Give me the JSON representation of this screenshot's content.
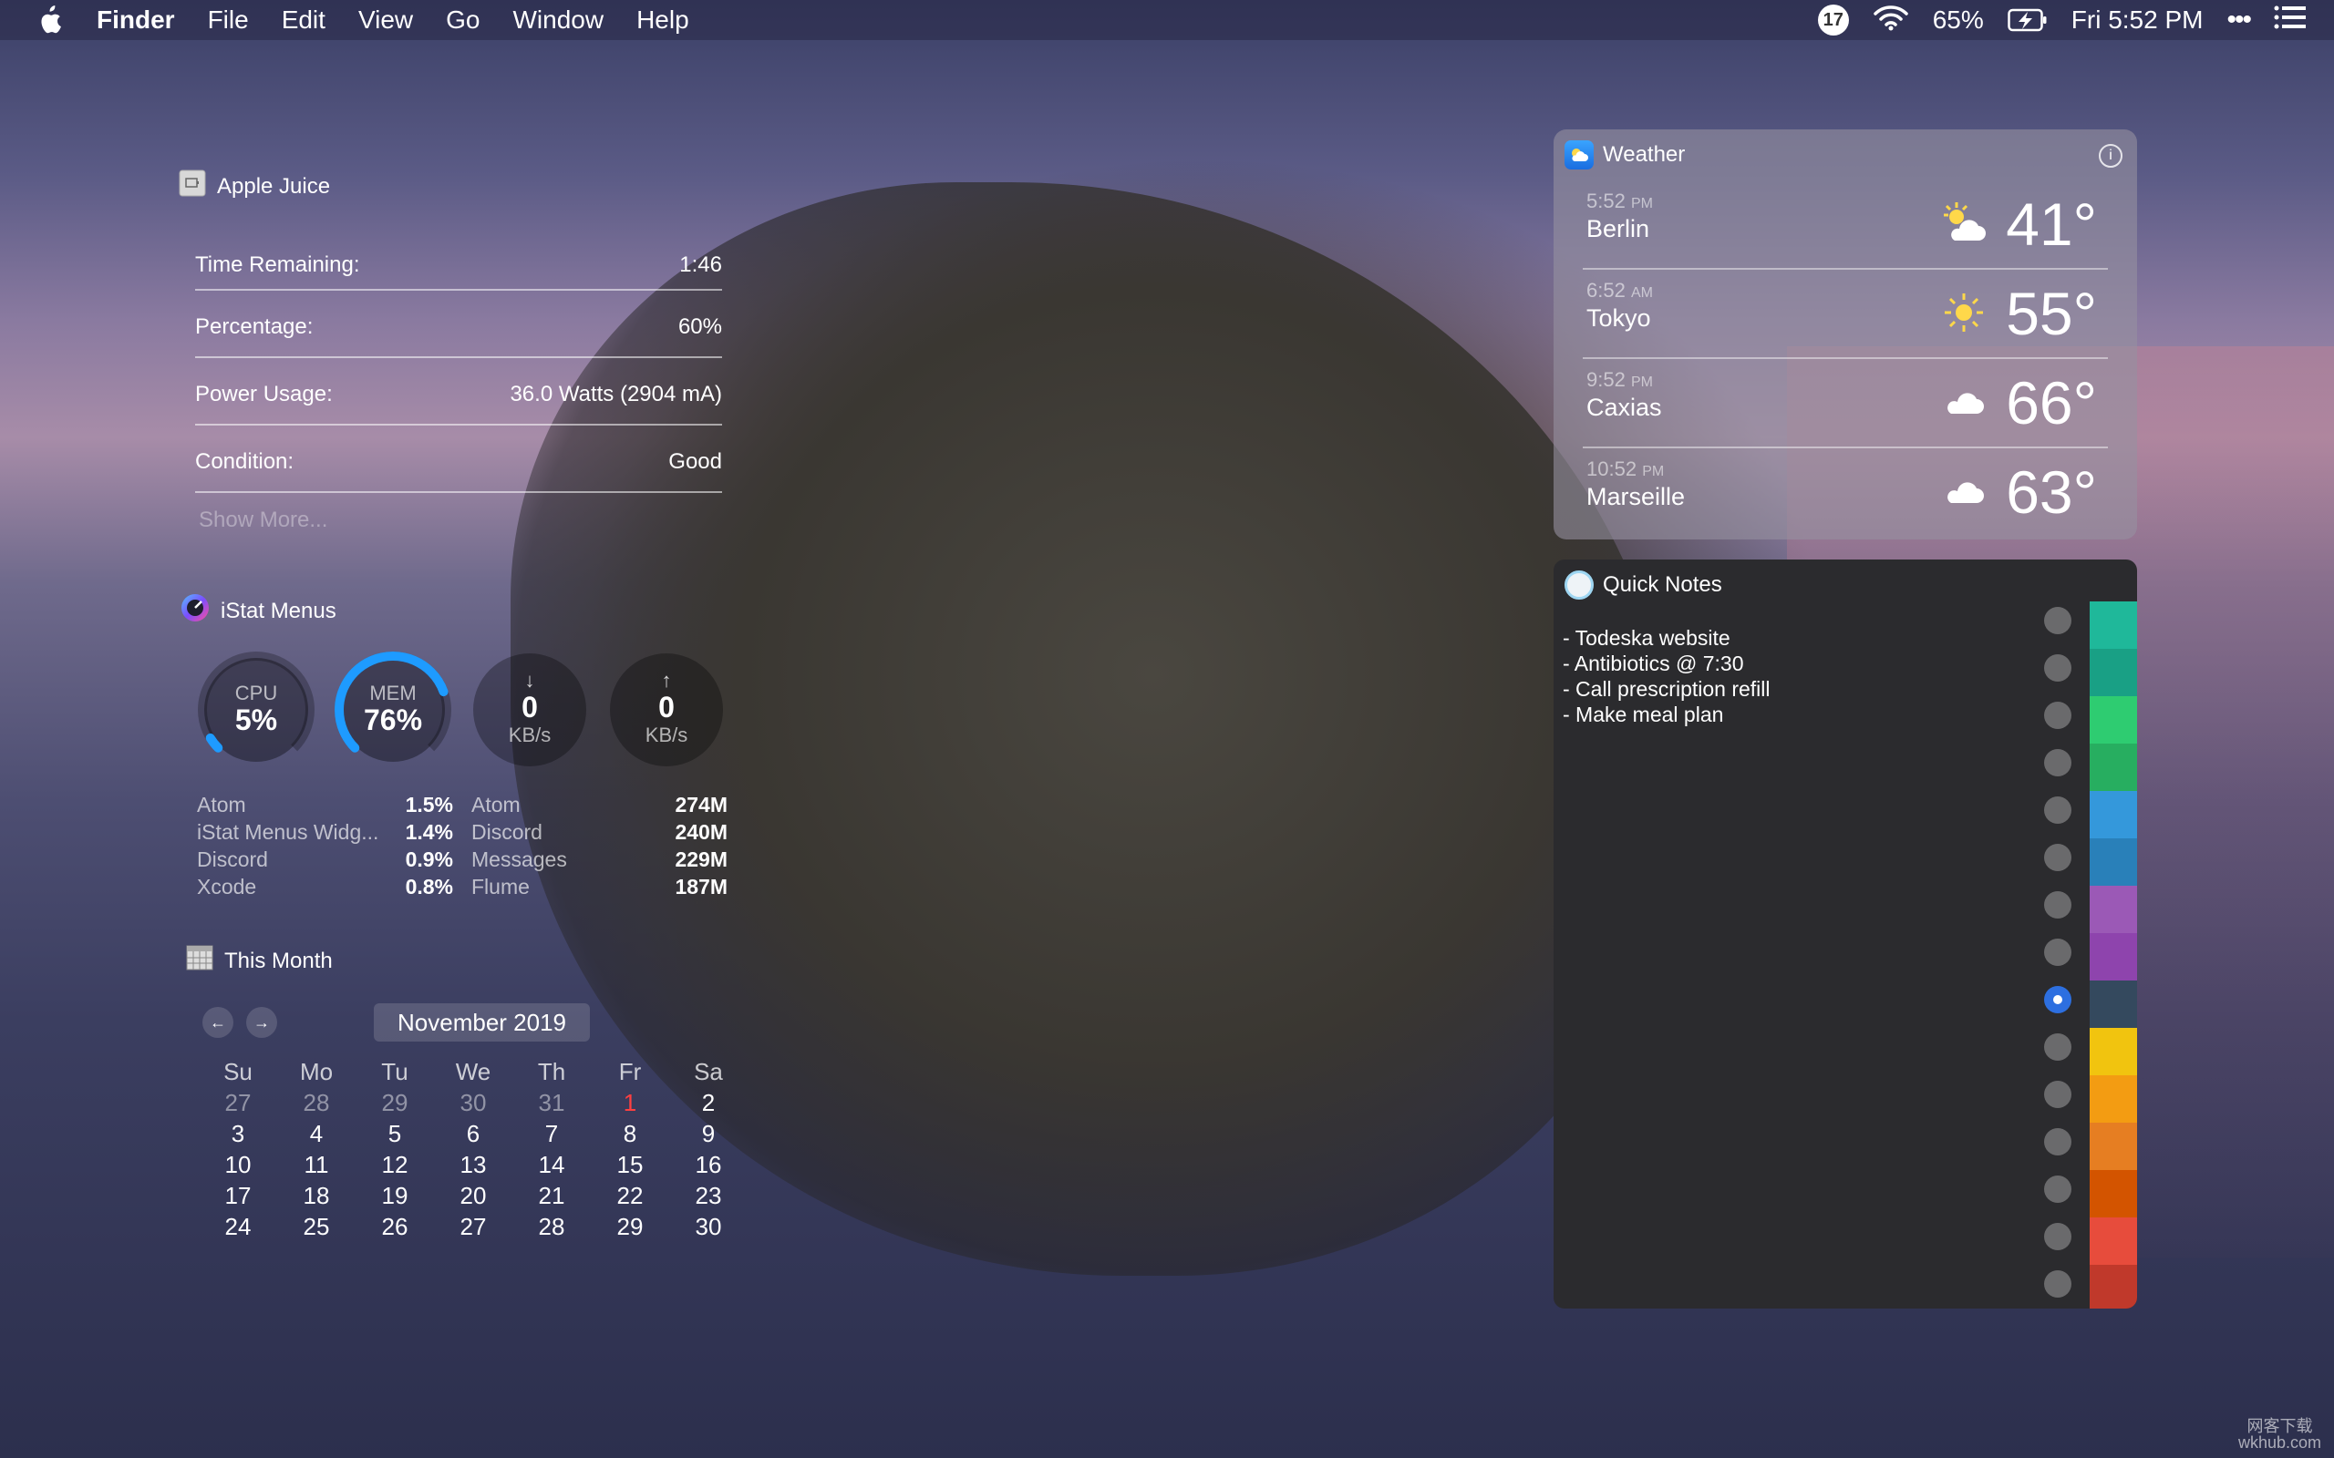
{
  "menubar": {
    "app": "Finder",
    "items": [
      "File",
      "Edit",
      "View",
      "Go",
      "Window",
      "Help"
    ],
    "calendar_badge": "17",
    "battery_percent": "65%",
    "clock": "Fri 5:52 PM"
  },
  "apple_juice": {
    "title": "Apple Juice",
    "rows": [
      {
        "label": "Time Remaining:",
        "value": "1:46"
      },
      {
        "label": "Percentage:",
        "value": "60%"
      },
      {
        "label": "Power Usage:",
        "value": "36.0 Watts (2904 mA)"
      },
      {
        "label": "Condition:",
        "value": "Good"
      }
    ],
    "show_more": "Show More..."
  },
  "istat": {
    "title": "iStat Menus",
    "cpu": {
      "label": "CPU",
      "value": "5%",
      "fraction": 0.05
    },
    "mem": {
      "label": "MEM",
      "value": "76%",
      "fraction": 0.76
    },
    "download": {
      "value": "0",
      "unit": "KB/s"
    },
    "upload": {
      "value": "0",
      "unit": "KB/s"
    },
    "cpu_procs": [
      {
        "name": "Atom",
        "value": "1.5%"
      },
      {
        "name": "iStat Menus Widg...",
        "value": "1.4%"
      },
      {
        "name": "Discord",
        "value": "0.9%"
      },
      {
        "name": "Xcode",
        "value": "0.8%"
      }
    ],
    "mem_procs": [
      {
        "name": "Atom",
        "value": "274M"
      },
      {
        "name": "Discord",
        "value": "240M"
      },
      {
        "name": "Messages",
        "value": "229M"
      },
      {
        "name": "Flume",
        "value": "187M"
      }
    ]
  },
  "this_month": {
    "title": "This Month",
    "month_label": "November 2019",
    "prev": "←",
    "next": "→",
    "weekdays": [
      "Su",
      "Mo",
      "Tu",
      "We",
      "Th",
      "Fr",
      "Sa"
    ],
    "weeks": [
      [
        {
          "d": "27",
          "s": "dim"
        },
        {
          "d": "28",
          "s": "dim"
        },
        {
          "d": "29",
          "s": "dim"
        },
        {
          "d": "30",
          "s": "dim"
        },
        {
          "d": "31",
          "s": "dim"
        },
        {
          "d": "1",
          "s": "today"
        },
        {
          "d": "2",
          "s": ""
        }
      ],
      [
        {
          "d": "3",
          "s": ""
        },
        {
          "d": "4",
          "s": ""
        },
        {
          "d": "5",
          "s": ""
        },
        {
          "d": "6",
          "s": ""
        },
        {
          "d": "7",
          "s": ""
        },
        {
          "d": "8",
          "s": ""
        },
        {
          "d": "9",
          "s": ""
        }
      ],
      [
        {
          "d": "10",
          "s": ""
        },
        {
          "d": "11",
          "s": ""
        },
        {
          "d": "12",
          "s": ""
        },
        {
          "d": "13",
          "s": ""
        },
        {
          "d": "14",
          "s": ""
        },
        {
          "d": "15",
          "s": ""
        },
        {
          "d": "16",
          "s": ""
        }
      ],
      [
        {
          "d": "17",
          "s": ""
        },
        {
          "d": "18",
          "s": ""
        },
        {
          "d": "19",
          "s": ""
        },
        {
          "d": "20",
          "s": ""
        },
        {
          "d": "21",
          "s": ""
        },
        {
          "d": "22",
          "s": ""
        },
        {
          "d": "23",
          "s": ""
        }
      ],
      [
        {
          "d": "24",
          "s": ""
        },
        {
          "d": "25",
          "s": ""
        },
        {
          "d": "26",
          "s": ""
        },
        {
          "d": "27",
          "s": ""
        },
        {
          "d": "28",
          "s": ""
        },
        {
          "d": "29",
          "s": ""
        },
        {
          "d": "30",
          "s": ""
        }
      ]
    ]
  },
  "weather": {
    "title": "Weather",
    "cities": [
      {
        "time": "5:52",
        "ampm": "PM",
        "city": "Berlin",
        "icon": "partly-cloudy-icon",
        "temp": "41°"
      },
      {
        "time": "6:52",
        "ampm": "AM",
        "city": "Tokyo",
        "icon": "sun-icon",
        "temp": "55°"
      },
      {
        "time": "9:52",
        "ampm": "PM",
        "city": "Caxias",
        "icon": "cloud-icon",
        "temp": "66°"
      },
      {
        "time": "10:52",
        "ampm": "PM",
        "city": "Marseille",
        "icon": "cloud-icon",
        "temp": "63°"
      }
    ]
  },
  "quick_notes": {
    "title": "Quick Notes",
    "lines": [
      "- Todeska website",
      "- Antibiotics @ 7:30",
      "- Call prescription refill",
      "- Make meal plan"
    ],
    "selected_index": 8,
    "colors": [
      "#1fb89a",
      "#19a085",
      "#2ecc71",
      "#27ae60",
      "#3498db",
      "#2980b9",
      "#9b59b6",
      "#8e44ad",
      "#34495e",
      "#f1c40f",
      "#f39c12",
      "#e67e22",
      "#d35400",
      "#e74c3c",
      "#c0392b"
    ]
  },
  "watermark": {
    "line1": "网客下载",
    "line2": "wkhub.com"
  }
}
